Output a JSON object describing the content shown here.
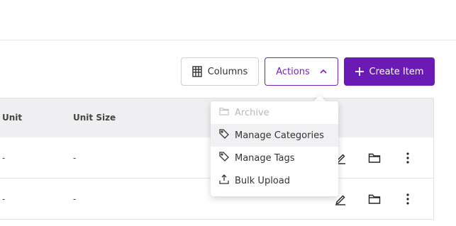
{
  "toolbar": {
    "columns_label": "Columns",
    "actions_label": "Actions",
    "create_label": "Create Item"
  },
  "table": {
    "headers": {
      "unit": "Unit",
      "unit_size": "Unit Size"
    },
    "rows": [
      {
        "unit": "-",
        "unit_size": "-"
      },
      {
        "unit": "-",
        "unit_size": "-"
      }
    ]
  },
  "actions_menu": {
    "items": [
      {
        "label": "Archive",
        "icon": "folder-icon",
        "disabled": true
      },
      {
        "label": "Manage Categories",
        "icon": "tag-icon",
        "disabled": false
      },
      {
        "label": "Manage Tags",
        "icon": "tag-icon",
        "disabled": false
      },
      {
        "label": "Bulk Upload",
        "icon": "upload-icon",
        "disabled": false
      }
    ]
  },
  "colors": {
    "accent": "#6a1bb3",
    "accent_outline": "#7a1fbf",
    "header_bg": "#efeff1",
    "disabled_text": "#b8b8bd"
  }
}
